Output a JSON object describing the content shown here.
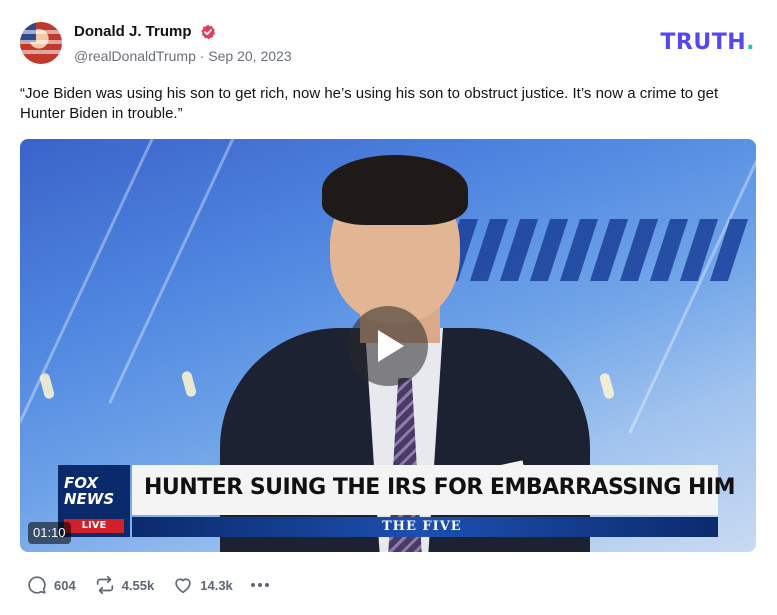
{
  "post": {
    "author": {
      "display_name": "Donald J. Trump",
      "handle": "@realDonaldTrump",
      "date": "Sep 20, 2023",
      "separator": "·",
      "verified_icon": "verified-badge-icon"
    },
    "brand": {
      "logo_text": "TRUTH",
      "logo_dot": ".",
      "color": "#5448ee",
      "dot_color": "#1ec8b0"
    },
    "text": "“Joe Biden was using his son to get rich, now he’s using his son to obstruct justice. It’s now a crime to get Hunter Biden in trouble.”",
    "video": {
      "duration": "01:10",
      "play_icon": "play-icon",
      "chyron": {
        "network_line1": "FOX",
        "network_line2": "NEWS",
        "live": "LIVE",
        "headline": "HUNTER SUING THE IRS FOR EMBARRASSING HIM",
        "show": "THE FIVE"
      }
    },
    "actions": {
      "replies": {
        "icon": "reply-icon",
        "count": "604"
      },
      "retruths": {
        "icon": "retruth-icon",
        "count": "4.55k"
      },
      "likes": {
        "icon": "heart-icon",
        "count": "14.3k"
      },
      "more_icon": "more-icon"
    }
  }
}
